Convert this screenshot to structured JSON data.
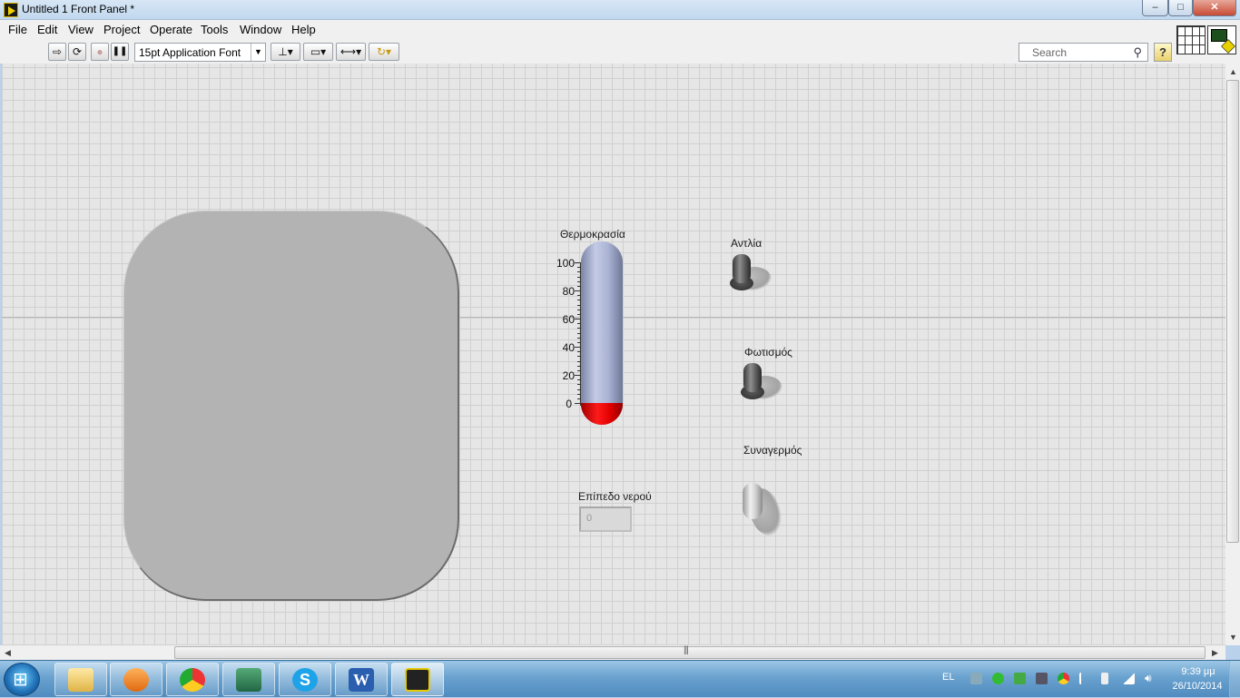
{
  "window": {
    "title": "Untitled 1 Front Panel *",
    "minimize": "–",
    "maximize": "□",
    "close": "✕"
  },
  "menu": [
    "File",
    "Edit",
    "View",
    "Project",
    "Operate",
    "Tools",
    "Window",
    "Help"
  ],
  "toolbar": {
    "run": "⇨",
    "run_continuously": "⟳",
    "abort": "●",
    "pause": "❚❚",
    "font": "15pt Application Font",
    "font_arrow": "▼",
    "align": "⊥▾",
    "distribute": "▭▾",
    "resize": "⟷▾",
    "reorder": "↻▾",
    "search_placeholder": "Search",
    "help": "?"
  },
  "panel": {
    "thermometer": {
      "label": "Θερμοκρασία",
      "ticks": [
        "100",
        "80",
        "60",
        "40",
        "20",
        "0"
      ],
      "value": 0
    },
    "toggles": [
      {
        "label": "Αντλία",
        "state": "off"
      },
      {
        "label": "Φωτισμός",
        "state": "off"
      },
      {
        "label": "Συναγερμός",
        "state": "on"
      }
    ],
    "level": {
      "label": "Επίπεδο νερού",
      "value": "0"
    }
  },
  "taskbar": {
    "apps": [
      "file-explorer",
      "media-player",
      "chrome",
      "device-manager",
      "skype",
      "word",
      "labview"
    ],
    "language": "EL",
    "time": "9:39 μμ",
    "date": "26/10/2014"
  }
}
